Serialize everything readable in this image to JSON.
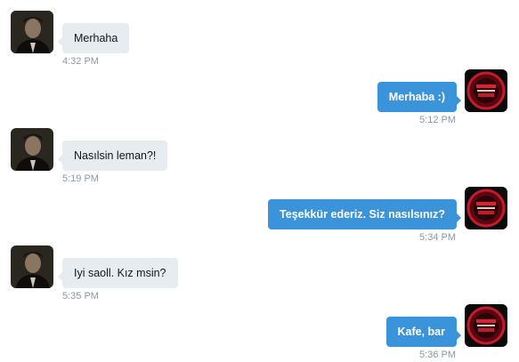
{
  "messages": [
    {
      "direction": "received",
      "text": "Merhaha",
      "time": "4:32 PM",
      "avatar": "user-portrait-avatar"
    },
    {
      "direction": "sent",
      "text": "Merhaba :)",
      "time": "5:12 PM",
      "avatar": "red-logo-avatar"
    },
    {
      "direction": "received",
      "text": "Nasılsin leman?!",
      "time": "5:19 PM",
      "avatar": "user-portrait-avatar"
    },
    {
      "direction": "sent",
      "text": "Teşekkür ederiz. Siz nasılsınız?",
      "time": "5:34 PM",
      "avatar": "red-logo-avatar"
    },
    {
      "direction": "received",
      "text": "Iyi saoll. Kız msin?",
      "time": "5:35 PM",
      "avatar": "user-portrait-avatar"
    },
    {
      "direction": "sent",
      "text": "Kafe, bar",
      "time": "5:36 PM",
      "avatar": "red-logo-avatar"
    }
  ],
  "colors": {
    "sent_bubble": "#3b94d9",
    "received_bubble": "#e6ecf0",
    "timestamp": "#8899a6"
  }
}
